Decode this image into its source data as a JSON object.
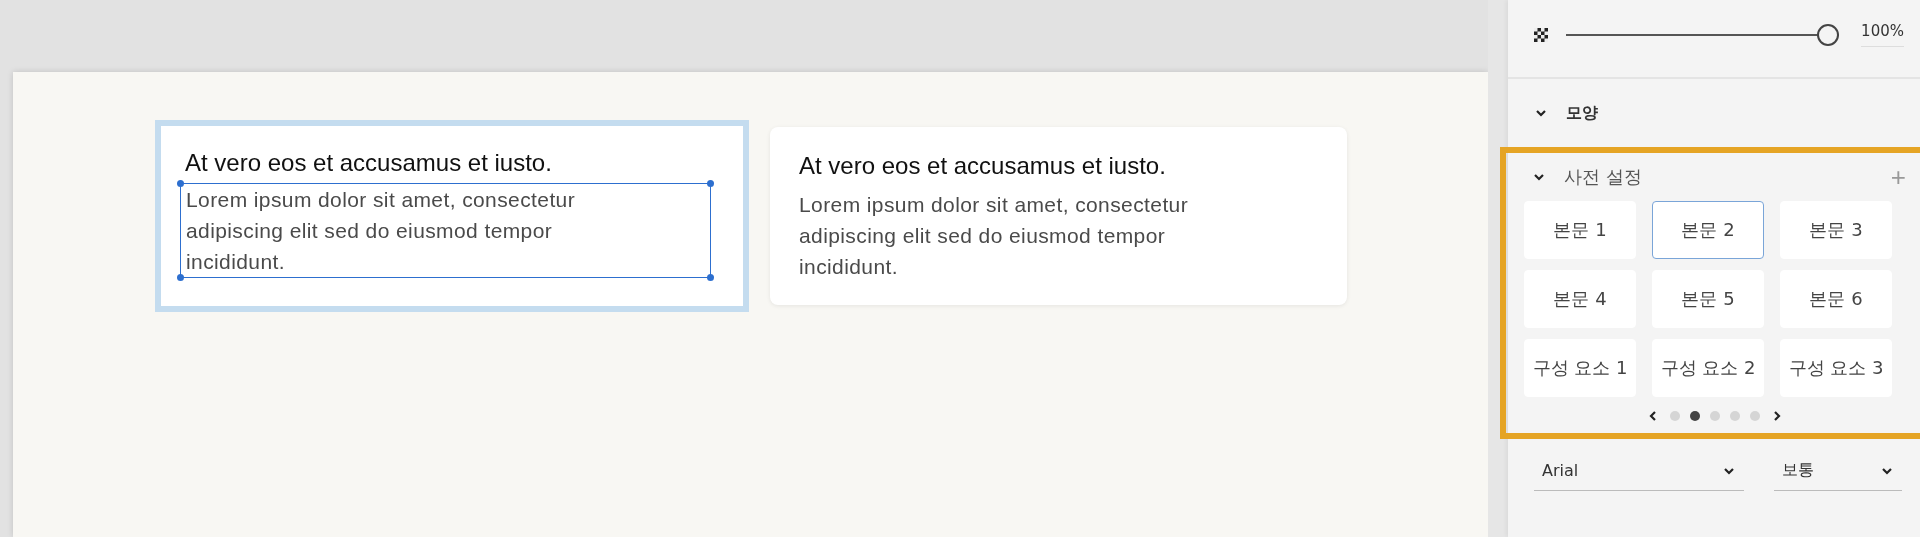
{
  "canvas": {
    "cards": [
      {
        "title": "At vero eos et accusamus et iusto.",
        "body": "Lorem ipsum dolor sit amet, consectetur adipiscing elit sed do eiusmod tempor incididunt.",
        "selected": true
      },
      {
        "title": "At vero eos et accusamus et iusto.",
        "body": "Lorem ipsum dolor sit amet, consectetur adipiscing elit sed do eiusmod tempor incididunt.",
        "selected": false
      }
    ]
  },
  "panel": {
    "opacity": {
      "level": 1,
      "value": "100%"
    },
    "sections": [
      {
        "title": "모양",
        "expanded": true
      }
    ],
    "presets": {
      "title": "사전 설정",
      "expanded": true,
      "add": "+",
      "items": [
        {
          "label": "본문 1",
          "selected": false
        },
        {
          "label": "본문 2",
          "selected": true
        },
        {
          "label": "본문 3",
          "selected": false
        },
        {
          "label": "본문 4",
          "selected": false
        },
        {
          "label": "본문 5",
          "selected": false
        },
        {
          "label": "본문 6",
          "selected": false
        },
        {
          "label": "구성 요소 1",
          "selected": false
        },
        {
          "label": "구성 요소 2",
          "selected": false
        },
        {
          "label": "구성 요소 3",
          "selected": false
        }
      ],
      "pages": [
        {
          "selected": false
        },
        {
          "selected": true
        },
        {
          "selected": false
        },
        {
          "selected": false
        },
        {
          "selected": false
        }
      ]
    },
    "font": {
      "family": "Arial",
      "weight": "보통"
    }
  }
}
